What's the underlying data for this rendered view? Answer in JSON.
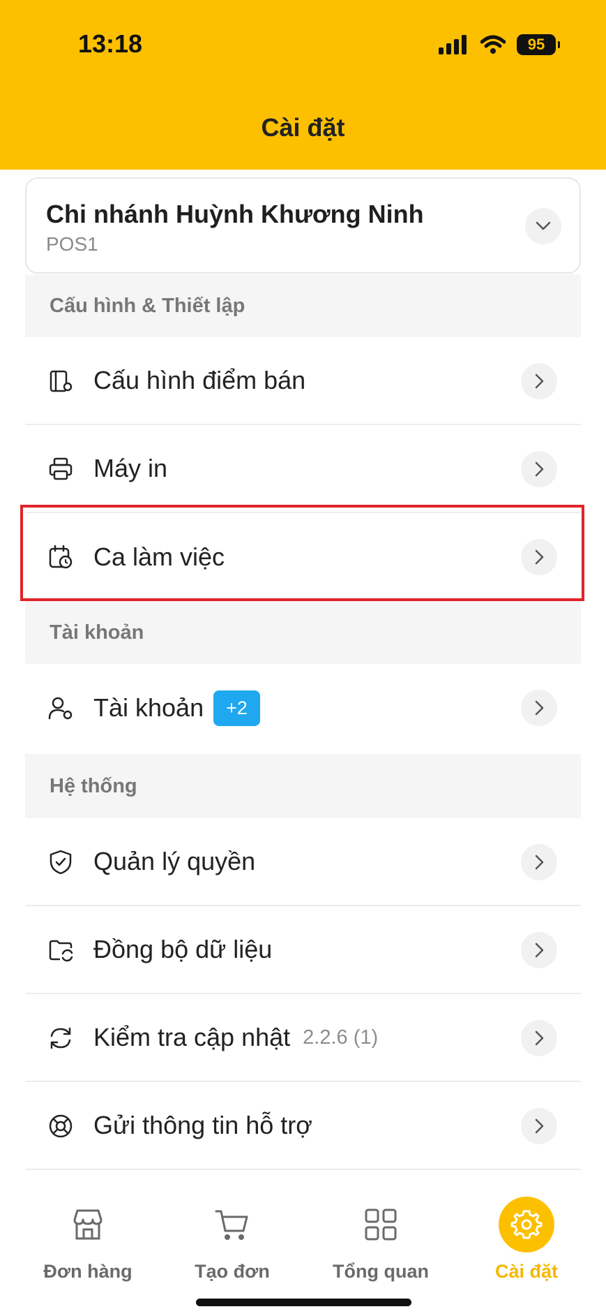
{
  "status_bar": {
    "time": "13:18",
    "battery": "95"
  },
  "header": {
    "title": "Cài đặt"
  },
  "branch": {
    "name": "Chi nhánh Huỳnh Khương Ninh",
    "sub": "POS1"
  },
  "sections": {
    "config": {
      "title": "Cấu hình & Thiết lập"
    },
    "account": {
      "title": "Tài khoản"
    },
    "system": {
      "title": "Hệ thống"
    }
  },
  "menu": {
    "pos_config": "Cấu hình điểm bán",
    "printer": "Máy in",
    "shift": "Ca làm việc",
    "account": "Tài khoản",
    "account_badge": "+2",
    "permissions": "Quản lý quyền",
    "sync": "Đồng bộ dữ liệu",
    "update": "Kiểm tra cập nhật",
    "update_version": "2.2.6 (1)",
    "support": "Gửi thông tin hỗ trợ"
  },
  "bottom_nav": {
    "orders": "Đơn hàng",
    "create": "Tạo đơn",
    "overview": "Tổng quan",
    "settings": "Cài đặt"
  },
  "colors": {
    "brand": "#fdc000",
    "highlight": "#e2232b",
    "badge": "#1fa8ef"
  }
}
